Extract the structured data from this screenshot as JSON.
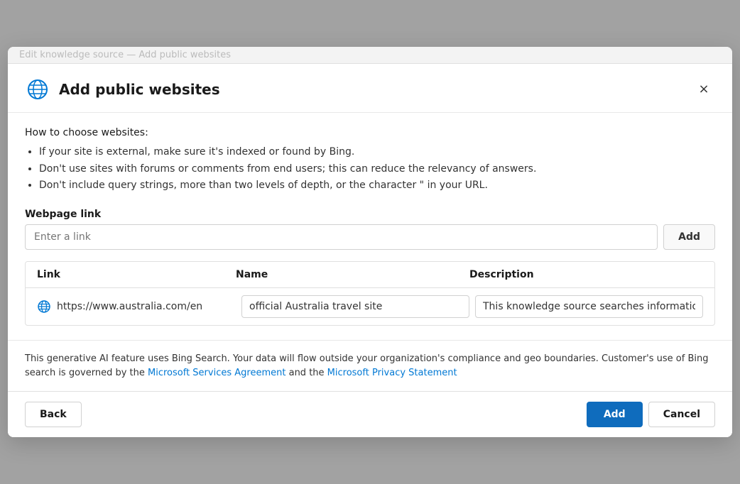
{
  "modal": {
    "title": "Add public websites",
    "close_label": "×"
  },
  "instructions": {
    "heading": "How to choose websites:",
    "bullets": [
      "If your site is external, make sure it's indexed or found by Bing.",
      "Don't use sites with forums or comments from end users; this can reduce the relevancy of answers.",
      "Don't include query strings, more than two levels of depth, or the character \" in your URL."
    ]
  },
  "form": {
    "label": "Webpage link",
    "input_placeholder": "Enter a link",
    "add_link_button_label": "Add"
  },
  "table": {
    "columns": [
      "Link",
      "Name",
      "Description"
    ],
    "rows": [
      {
        "link": "https://www.australia.com/en",
        "name": "official Australia travel site",
        "description": "This knowledge source searches information a"
      }
    ]
  },
  "disclaimer": {
    "text_before_link1": "This generative AI feature uses Bing Search. Your data will flow outside your organization's compliance and geo boundaries. Customer's use of Bing search is governed by the ",
    "link1_label": "Microsoft Services Agreement",
    "text_between": " and the ",
    "link2_label": "Microsoft Privacy Statement",
    "text_after": ""
  },
  "footer": {
    "back_label": "Back",
    "add_label": "Add",
    "cancel_label": "Cancel"
  }
}
